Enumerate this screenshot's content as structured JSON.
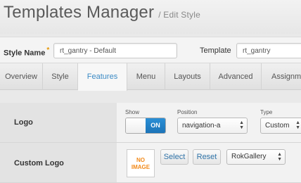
{
  "header": {
    "title": "Templates Manager",
    "subtitle": "/ Edit Style"
  },
  "style_name": {
    "label": "Style Name",
    "required_marker": "*",
    "value": "rt_gantry - Default"
  },
  "template": {
    "label": "Template",
    "value": "rt_gantry"
  },
  "tabs": [
    {
      "label": "Overview",
      "active": false
    },
    {
      "label": "Style",
      "active": false
    },
    {
      "label": "Features",
      "active": true
    },
    {
      "label": "Menu",
      "active": false
    },
    {
      "label": "Layouts",
      "active": false
    },
    {
      "label": "Advanced",
      "active": false
    },
    {
      "label": "Assignme",
      "active": false
    }
  ],
  "logo_row": {
    "label": "Logo",
    "show_label": "Show",
    "toggle_on_label": "ON",
    "toggle_state": "on",
    "position_label": "Position",
    "position_value": "navigation-a",
    "type_label": "Type",
    "type_value": "Custom"
  },
  "custom_logo_row": {
    "label": "Custom Logo",
    "no_image_line1": "NO",
    "no_image_line2": "IMAGE",
    "select_label": "Select",
    "reset_label": "Reset",
    "gallery_value": "RokGallery"
  },
  "colors": {
    "accent": "#3b8ac4",
    "toggle_on": "#1c74b8",
    "no_image": "#f28a1a",
    "required": "#e59400"
  },
  "icons": [
    "select-arrows-icon"
  ]
}
